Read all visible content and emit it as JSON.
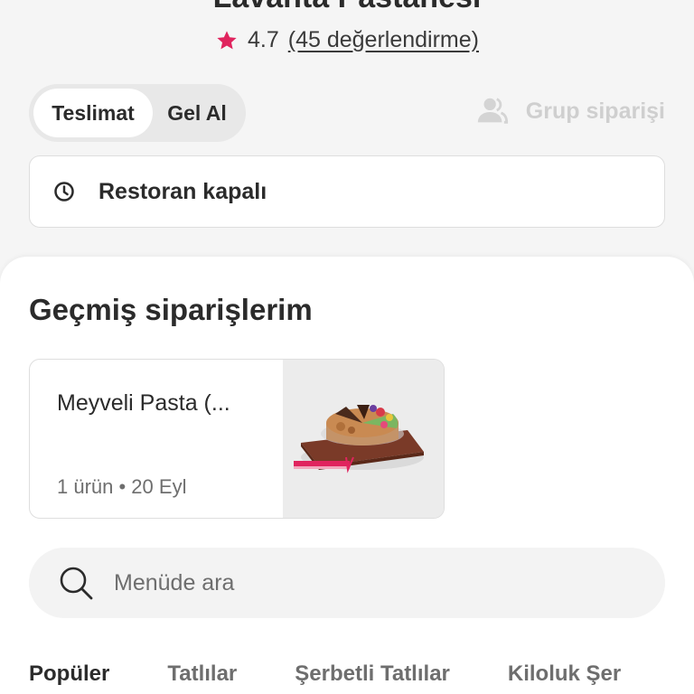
{
  "store": {
    "title": "Lavanta Pastanesi",
    "rating": "4.7",
    "rating_count": "(45 değerlendirme)"
  },
  "delivery_modes": [
    {
      "label": "Teslimat",
      "active": true
    },
    {
      "label": "Gel Al",
      "active": false
    }
  ],
  "group_order": {
    "label": "Grup siparişi",
    "icon": "group-icon"
  },
  "status": {
    "text": "Restoran kapalı",
    "icon": "clock-icon"
  },
  "past_orders": {
    "title": "Geçmiş siparişlerim",
    "items": [
      {
        "name": "Meyveli Pasta (...",
        "meta": "1 ürün • 20 Eyl"
      }
    ]
  },
  "search": {
    "placeholder": "Menüde ara",
    "icon": "search-icon"
  },
  "categories": [
    {
      "label": "Popüler",
      "active": true
    },
    {
      "label": "Tatlılar",
      "active": false
    },
    {
      "label": "Şerbetli Tatlılar",
      "active": false
    },
    {
      "label": "Kiloluk Şer",
      "active": false
    }
  ],
  "colors": {
    "accent": "#e0245e",
    "muted": "#cfcfcf",
    "text": "#2b2b2b"
  }
}
